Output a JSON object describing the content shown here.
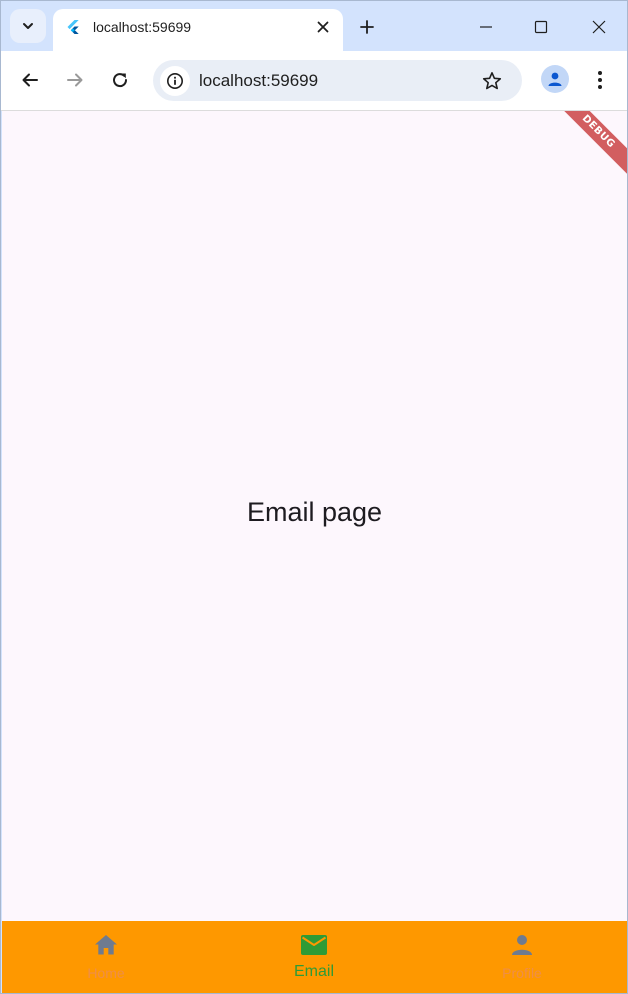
{
  "browser": {
    "tab": {
      "title": "localhost:59699",
      "favicon": "flutter-icon"
    },
    "window_controls": [
      "minimize-icon",
      "maximize-icon",
      "close-icon"
    ],
    "toolbar": {
      "url": "localhost:59699"
    }
  },
  "app": {
    "body_text": "Email page",
    "debug_banner": "DEBUG",
    "bottom_nav": {
      "background": "#fe9800",
      "selected": "Email",
      "items": [
        {
          "label": "Home",
          "icon": "home-icon",
          "color": "#6f7b8f"
        },
        {
          "label": "Email",
          "icon": "email-icon",
          "color": "#2f9b36"
        },
        {
          "label": "Profile",
          "icon": "person-icon",
          "color": "#6f7b8f"
        }
      ]
    }
  }
}
